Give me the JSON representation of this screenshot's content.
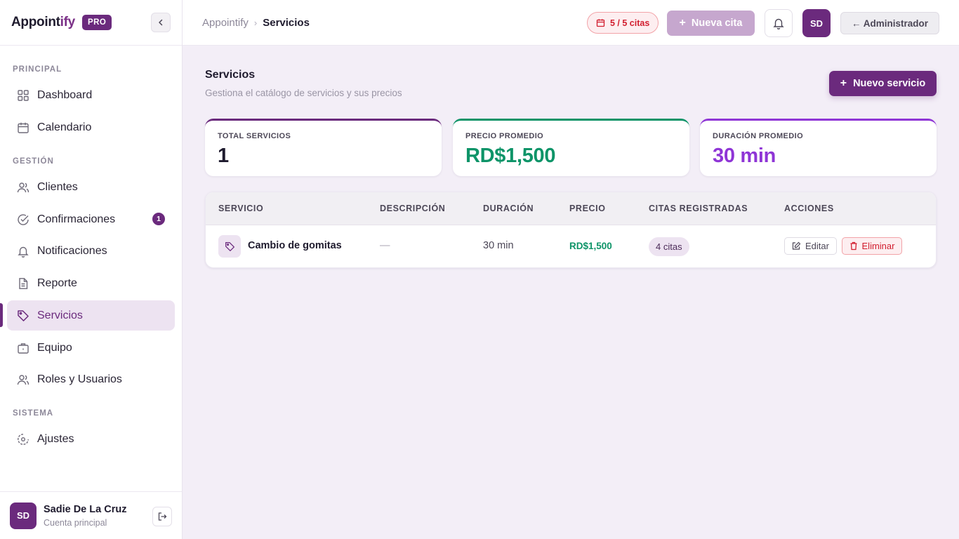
{
  "brand": {
    "name_main": "Appoint",
    "name_accent": "ify",
    "badge": "PRO"
  },
  "colors": {
    "primary": "#6b2a7d",
    "green": "#0e9468",
    "violet": "#8f35d6",
    "danger": "#d21e2f"
  },
  "sidebar": {
    "sections": [
      {
        "label": "PRINCIPAL"
      },
      {
        "label": "GESTIÓN"
      },
      {
        "label": "SISTEMA"
      }
    ],
    "items": [
      {
        "label": "Dashboard",
        "icon": "grid-icon"
      },
      {
        "label": "Calendario",
        "icon": "calendar-icon"
      },
      {
        "label": "Clientes",
        "icon": "users-icon"
      },
      {
        "label": "Confirmaciones",
        "icon": "check-circle-icon",
        "badge": "1"
      },
      {
        "label": "Notificaciones",
        "icon": "bell-icon"
      },
      {
        "label": "Reporte",
        "icon": "document-icon"
      },
      {
        "label": "Servicios",
        "icon": "tag-icon",
        "active": true
      },
      {
        "label": "Equipo",
        "icon": "briefcase-icon"
      },
      {
        "label": "Roles y Usuarios",
        "icon": "users-icon"
      },
      {
        "label": "Ajustes",
        "icon": "settings-icon"
      }
    ],
    "user": {
      "initials": "SD",
      "name": "Sadie De La Cruz",
      "role": "Cuenta principal"
    }
  },
  "header": {
    "breadcrumb_root": "Appointify",
    "breadcrumb_sep": "›",
    "breadcrumb_current": "Servicios",
    "citas_usage": "5 / 5 citas",
    "new_appointment": "Nueva cita",
    "avatar_initials": "SD",
    "admin_button": "← Administrador"
  },
  "page": {
    "title": "Servicios",
    "subtitle": "Gestiona el catálogo de servicios y sus precios",
    "new_service": "Nuevo servicio"
  },
  "stats": [
    {
      "label": "TOTAL SERVICIOS",
      "value": "1"
    },
    {
      "label": "PRECIO PROMEDIO",
      "value": "RD$1,500"
    },
    {
      "label": "DURACIÓN PROMEDIO",
      "value": "30 min"
    }
  ],
  "table": {
    "columns": [
      "SERVICIO",
      "DESCRIPCIÓN",
      "DURACIÓN",
      "PRECIO",
      "CITAS REGISTRADAS",
      "ACCIONES"
    ],
    "rows": [
      {
        "name": "Cambio de gomitas",
        "description": "—",
        "duration": "30 min",
        "price": "RD$1,500",
        "citas": "4 citas",
        "edit": "Editar",
        "delete": "Eliminar"
      }
    ]
  }
}
